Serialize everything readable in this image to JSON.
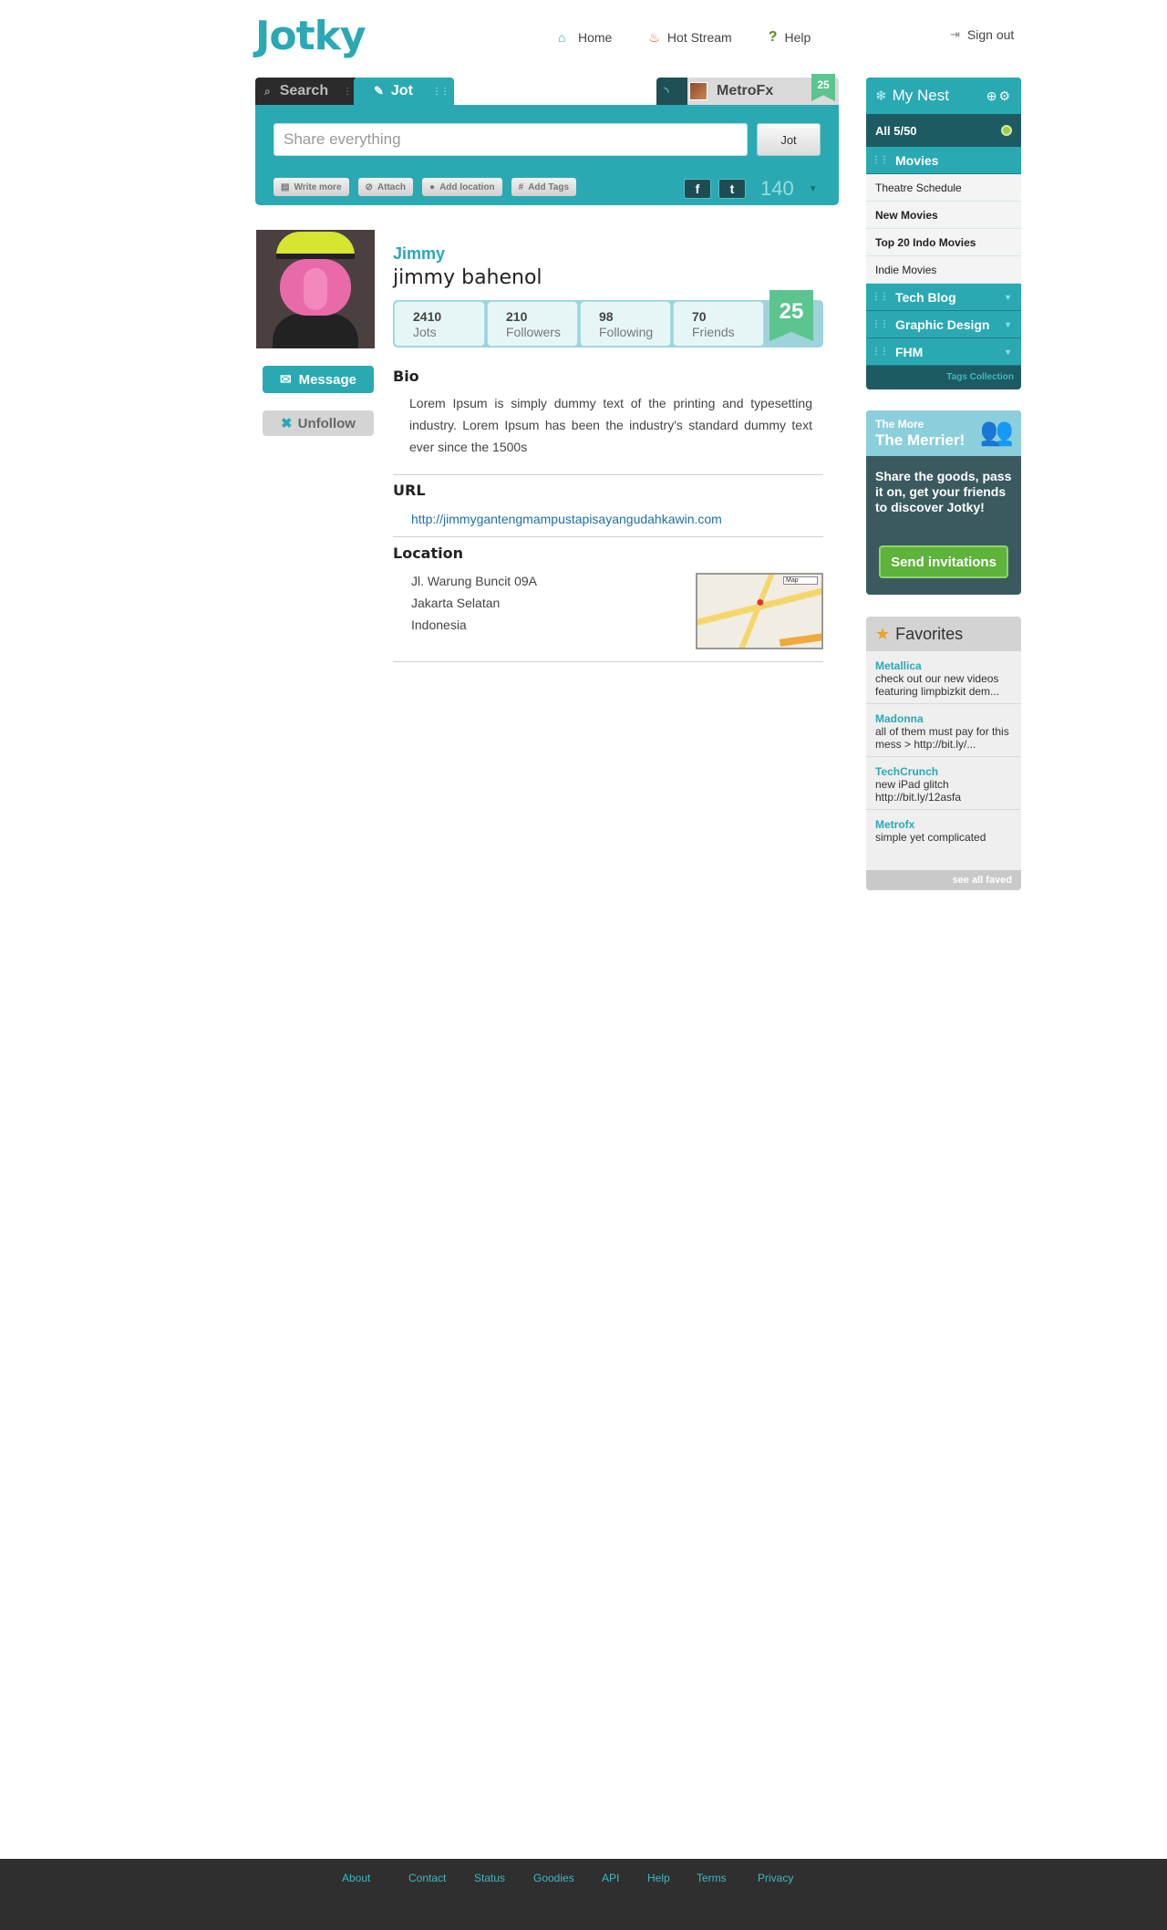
{
  "brand": {
    "logo": "Jotky",
    "accent": "#2aa9b3",
    "dark": "#1d5a62",
    "green": "#5cc48f"
  },
  "topnav": {
    "home": "Home",
    "hot_stream": "Hot Stream",
    "help": "Help",
    "sign_out": "Sign out"
  },
  "composer": {
    "tab_search": "Search",
    "tab_jot": "Jot",
    "tab_user": "MetroFx",
    "tab_user_count": "25",
    "placeholder": "Share everything",
    "jot_button": "Jot",
    "tools": {
      "write_more": "Write more",
      "attach": "Attach",
      "add_location": "Add location",
      "add_tags": "Add Tags"
    },
    "facebook": "f",
    "twitter": "t",
    "char_count": "140"
  },
  "profile": {
    "username": "Jimmy",
    "fullname": "jimmy bahenol",
    "message_button": "Message",
    "unfollow_button": "Unfollow",
    "stats": [
      {
        "value": "2410",
        "label": "Jots"
      },
      {
        "value": "210",
        "label": "Followers"
      },
      {
        "value": "98",
        "label": "Following"
      },
      {
        "value": "70",
        "label": "Friends"
      }
    ],
    "ribbon": "25",
    "bio_title": "Bio",
    "bio": "Lorem Ipsum is simply dummy text of the printing and typesetting industry. Lorem Ipsum has been the industry's standard dummy text ever since the 1500s",
    "url_title": "URL",
    "url": "http://jimmygantengmampustapisayangudahkawin.com",
    "location_title": "Location",
    "location": [
      "Jl. Warung Buncit 09A",
      "Jakarta Selatan",
      "Indonesia"
    ],
    "map_button": "Map"
  },
  "nest": {
    "title": "My Nest",
    "all": "All  5/50",
    "groups": [
      {
        "name": "Movies",
        "items": [
          {
            "label": "Theatre Schedule",
            "bold": false
          },
          {
            "label": "New Movies",
            "bold": true
          },
          {
            "label": "Top 20 Indo Movies",
            "bold": true
          },
          {
            "label": "Indie Movies",
            "bold": false
          }
        ]
      },
      {
        "name": "Tech Blog"
      },
      {
        "name": "Graphic Design"
      },
      {
        "name": "FHM"
      }
    ],
    "footer": "Tags Collection"
  },
  "invite": {
    "line1": "The More",
    "line2": "The Merrier!",
    "body": "Share the goods, pass it on, get your friends to discover Jotky!",
    "button": "Send invitations"
  },
  "favorites": {
    "title": "Favorites",
    "items": [
      {
        "who": "Metallica",
        "text": "check out our new videos featuring limpbizkit dem..."
      },
      {
        "who": "Madonna",
        "text": "all of them must pay for this mess > http://bit.ly/..."
      },
      {
        "who": "TechCrunch",
        "text": "new iPad glitch http://bit.ly/12asfa"
      },
      {
        "who": "Metrofx",
        "text": "simple yet complicated"
      }
    ],
    "footer": "see all faved"
  },
  "footer": {
    "links": [
      "About",
      "Contact",
      "Status",
      "Goodies",
      "API",
      "Help",
      "Terms",
      "Privacy"
    ]
  }
}
